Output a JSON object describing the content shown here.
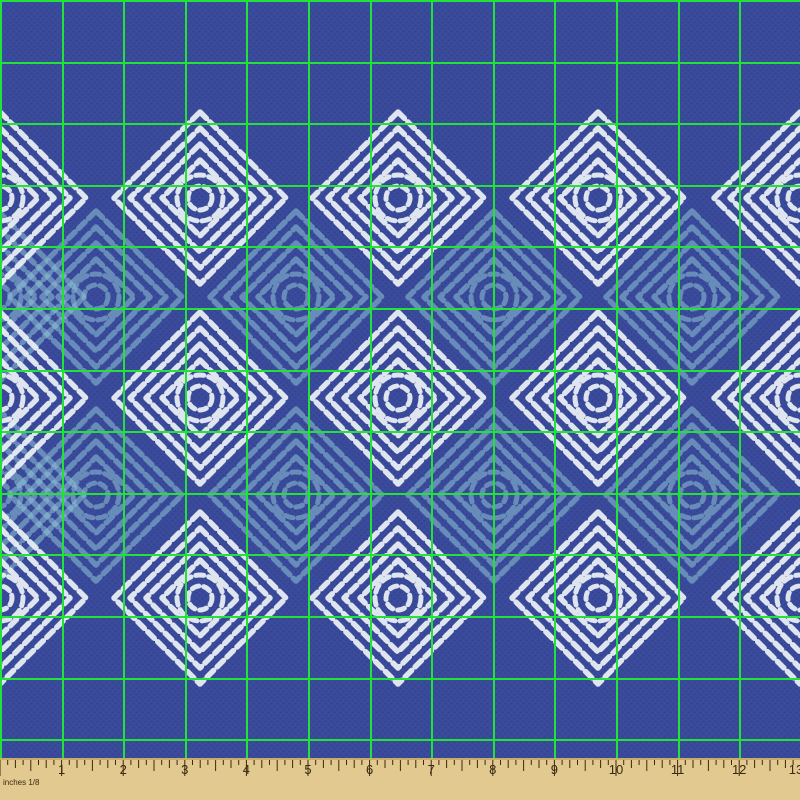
{
  "fabric": {
    "colors": {
      "background": "#3b4b9c",
      "weave_dark": "#34438f",
      "stitch_white": "#e8eef4",
      "stitch_teal": "#8fc4d6",
      "grid_line": "#22e23a"
    },
    "grid_on": true
  },
  "ruler": {
    "unit_label": "inches 1/8",
    "numbers": [
      "1",
      "2",
      "3",
      "4",
      "5",
      "6",
      "7",
      "8",
      "9",
      "10",
      "11",
      "12",
      "13"
    ],
    "colors": {
      "wood": "#e2c98f",
      "wood_dark": "#c9ac6c",
      "ink": "#3a2a10"
    }
  }
}
